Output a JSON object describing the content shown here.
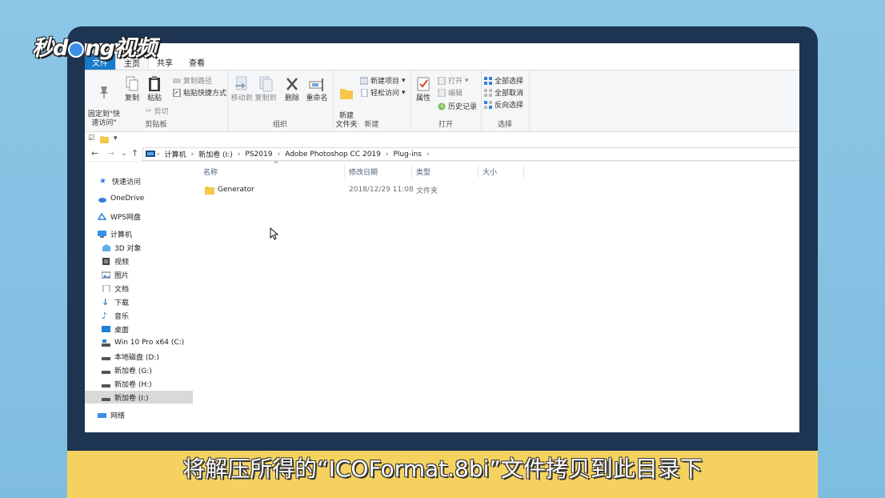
{
  "brand": {
    "logo_text_1": "秒",
    "logo_text_2": "d",
    "logo_text_3": "ng视频"
  },
  "caption": "将解压所得的“ICOFormat.8bi”文件拷贝到此目录下",
  "tabs": {
    "file": "文件",
    "home": "主页",
    "share": "共享",
    "view": "查看"
  },
  "ribbon": {
    "clipboard": {
      "label": "剪贴板",
      "pin": "固定到\"快\n速访问\"",
      "copy": "复制",
      "paste": "粘贴",
      "copy_path": "复制路径",
      "paste_shortcut": "粘贴快捷方式",
      "cut": "剪切"
    },
    "organize": {
      "label": "组织",
      "move_to": "移动到",
      "copy_to": "复制到",
      "delete": "删除",
      "rename": "重命名"
    },
    "new": {
      "label": "新建",
      "new_folder": "新建\n文件夹",
      "new_item": "新建项目",
      "easy_access": "轻松访问"
    },
    "open": {
      "label": "打开",
      "properties": "属性",
      "open": "打开",
      "edit": "编辑",
      "history": "历史记录"
    },
    "select": {
      "label": "选择",
      "select_all": "全部选择",
      "select_none": "全部取消",
      "invert": "反向选择"
    }
  },
  "address": {
    "crumbs": [
      "计算机",
      "新加卷 (I:)",
      "PS2019",
      "Adobe Photoshop CC 2019",
      "Plug-ins"
    ]
  },
  "sidebar": {
    "quick_access": "快速访问",
    "onedrive": "OneDrive",
    "wps": "WPS网盘",
    "computer": "计算机",
    "items": [
      "3D 对象",
      "视频",
      "图片",
      "文档",
      "下载",
      "音乐",
      "桌面",
      "Win 10 Pro x64 (C:)",
      "本地磁盘 (D:)",
      "新加卷 (G:)",
      "新加卷 (H:)",
      "新加卷 (I:)"
    ],
    "network": "网络"
  },
  "columns": {
    "name": "名称",
    "modified": "修改日期",
    "type": "类型",
    "size": "大小"
  },
  "files": [
    {
      "name": "Generator",
      "modified": "2018/12/29 11:08",
      "type": "文件夹",
      "size": ""
    }
  ],
  "colors": {
    "file_tab": "#1979ca",
    "frame": "#1d3552",
    "caption_bar": "#f5d260",
    "folder": "#f5c84c"
  }
}
